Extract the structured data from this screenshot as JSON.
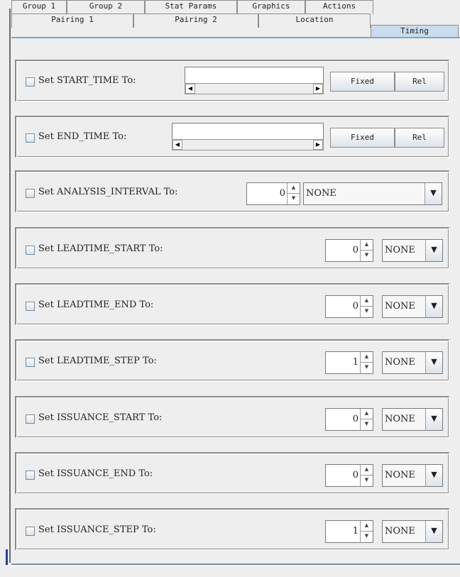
{
  "tabs": {
    "row_top": [
      {
        "label": "Group 1"
      },
      {
        "label": "Group 2"
      },
      {
        "label": "Stat Params"
      },
      {
        "label": "Graphics"
      },
      {
        "label": "Actions"
      }
    ],
    "row_bottom": [
      {
        "label": "Pairing 1"
      },
      {
        "label": "Pairing 2"
      },
      {
        "label": "Location"
      },
      {
        "label": "Timing",
        "selected": true
      }
    ]
  },
  "start_time": {
    "label": "Set START_TIME To:",
    "value": "",
    "fixed_label": "Fixed",
    "rel_label": "Rel"
  },
  "end_time": {
    "label": "Set END_TIME To:",
    "value": "",
    "fixed_label": "Fixed",
    "rel_label": "Rel"
  },
  "analysis_interval": {
    "label": "Set ANALYSIS_INTERVAL To:",
    "value": "0",
    "unit": "NONE"
  },
  "rows": [
    {
      "label": "Set LEADTIME_START To:",
      "value": "0",
      "unit": "NONE"
    },
    {
      "label": "Set LEADTIME_END To:",
      "value": "0",
      "unit": "NONE"
    },
    {
      "label": "Set LEADTIME_STEP To:",
      "value": "1",
      "unit": "NONE"
    },
    {
      "label": "Set ISSUANCE_START To:",
      "value": "0",
      "unit": "NONE"
    },
    {
      "label": "Set ISSUANCE_END To:",
      "value": "0",
      "unit": "NONE"
    },
    {
      "label": "Set ISSUANCE_STEP To:",
      "value": "1",
      "unit": "NONE"
    }
  ],
  "icons": {
    "scroll_left": "◀",
    "scroll_right": "▶",
    "spin_up": "▲",
    "spin_down": "▼",
    "dropdown": "▼"
  },
  "colors": {
    "selected_tab": "#c9dbec",
    "panel_border": "#7ea5c8"
  }
}
